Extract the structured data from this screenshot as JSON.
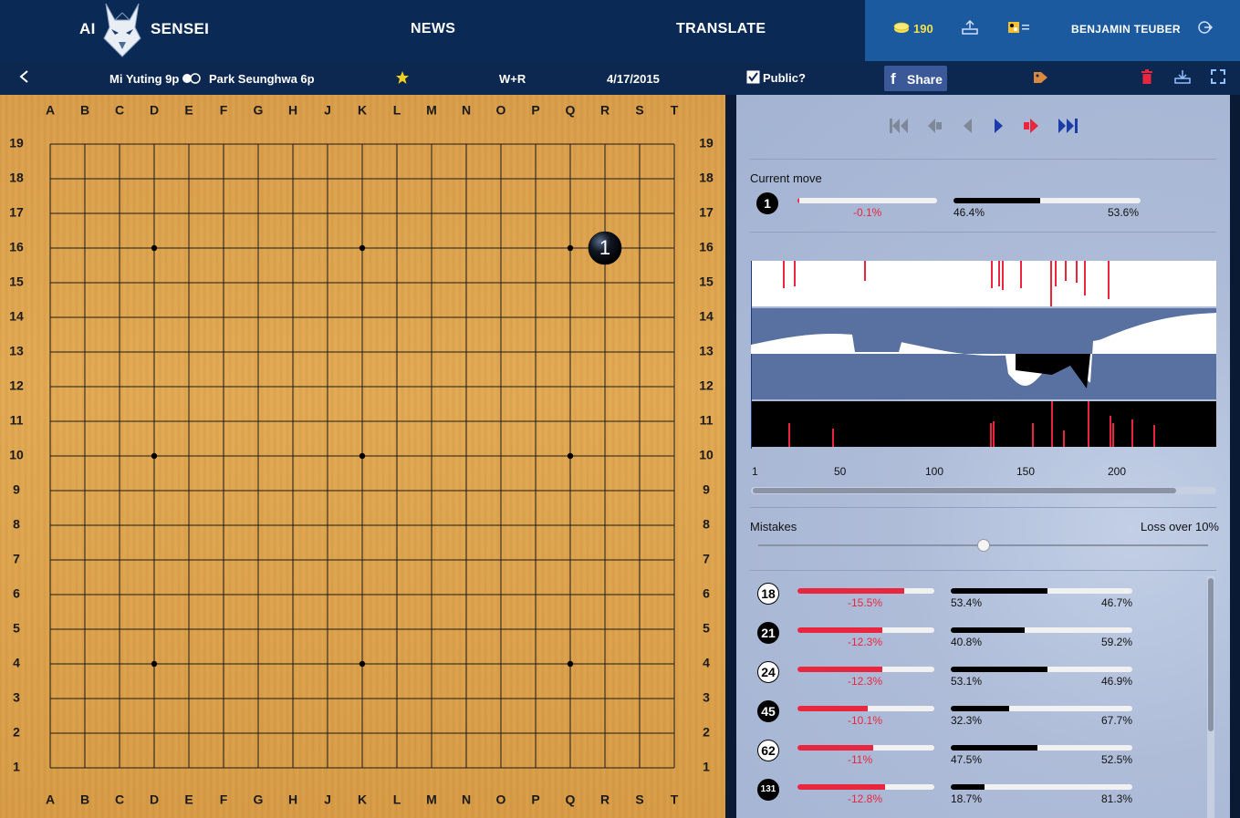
{
  "brand": {
    "left": "AI",
    "right": "SENSEI"
  },
  "nav": {
    "news": "NEWS",
    "translate": "TRANSLATE"
  },
  "account": {
    "credits": "190",
    "user": "BENJAMIN TEUBER"
  },
  "game": {
    "black_player": "Mi Yuting 9p",
    "white_player": "Park Seunghwa 6p",
    "result": "W+R",
    "date": "4/17/2015",
    "public_label": "Public?",
    "public_checked": true,
    "share_label": "Share"
  },
  "board": {
    "cols": [
      "A",
      "B",
      "C",
      "D",
      "E",
      "F",
      "G",
      "H",
      "J",
      "K",
      "L",
      "M",
      "N",
      "O",
      "P",
      "Q",
      "R",
      "S",
      "T"
    ],
    "rows": [
      19,
      18,
      17,
      16,
      15,
      14,
      13,
      12,
      11,
      10,
      9,
      8,
      7,
      6,
      5,
      4,
      3,
      2,
      1
    ],
    "stones": [
      {
        "coord": "R16",
        "color": "black",
        "number": "1"
      }
    ]
  },
  "current_move": {
    "label": "Current move",
    "move": "1",
    "loss": "-0.1%",
    "loss_fraction": 0.01,
    "black_pct": "46.4%",
    "white_pct": "53.6%",
    "black_fraction": 0.464
  },
  "graph": {
    "x_ticks": [
      "1",
      "50",
      "100",
      "150",
      "200"
    ],
    "scroll_fraction": 0.92
  },
  "mistakes": {
    "label": "Mistakes",
    "threshold_label": "Loss over 10%",
    "slider_fraction": 0.5,
    "items": [
      {
        "move": "18",
        "stone": "white",
        "loss": "-15.5%",
        "loss_fraction": 0.78,
        "black_pct": "53.4%",
        "white_pct": "46.7%",
        "black_fraction": 0.534
      },
      {
        "move": "21",
        "stone": "black",
        "loss": "-12.3%",
        "loss_fraction": 0.62,
        "black_pct": "40.8%",
        "white_pct": "59.2%",
        "black_fraction": 0.408
      },
      {
        "move": "24",
        "stone": "white",
        "loss": "-12.3%",
        "loss_fraction": 0.62,
        "black_pct": "53.1%",
        "white_pct": "46.9%",
        "black_fraction": 0.531
      },
      {
        "move": "45",
        "stone": "black",
        "loss": "-10.1%",
        "loss_fraction": 0.51,
        "black_pct": "32.3%",
        "white_pct": "67.7%",
        "black_fraction": 0.323
      },
      {
        "move": "62",
        "stone": "white",
        "loss": "-11%",
        "loss_fraction": 0.55,
        "black_pct": "47.5%",
        "white_pct": "52.5%",
        "black_fraction": 0.475
      },
      {
        "move": "131",
        "stone": "black",
        "loss": "-12.8%",
        "loss_fraction": 0.64,
        "black_pct": "18.7%",
        "white_pct": "81.3%",
        "black_fraction": 0.187
      }
    ]
  },
  "colors": {
    "accent": "#1c5aa0",
    "nav": "#0a2a55",
    "loss_red": "#e8263e",
    "facebook": "#3b5998"
  }
}
